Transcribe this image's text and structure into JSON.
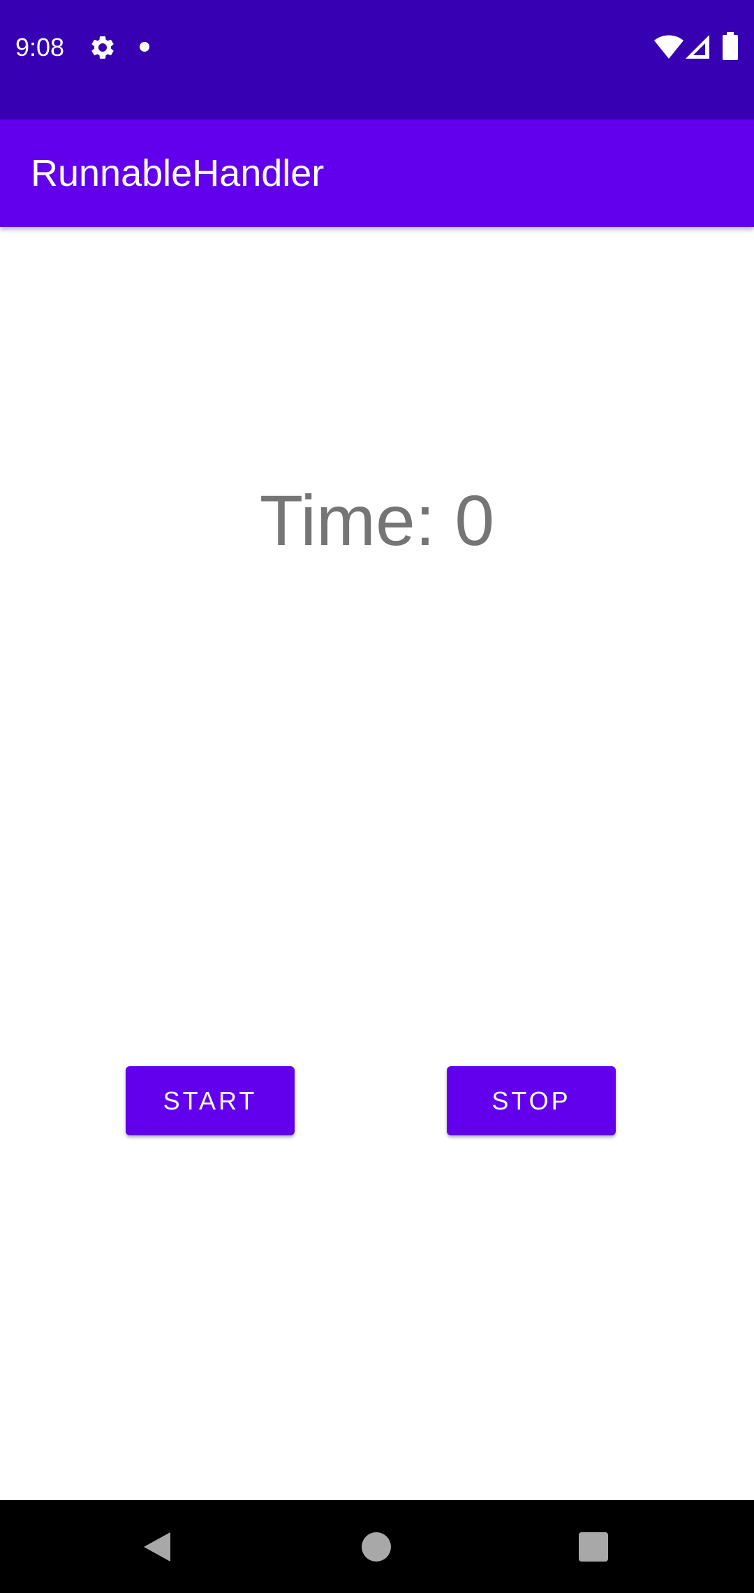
{
  "status_bar": {
    "time": "9:08",
    "icons": [
      "gear-icon",
      "notification-dot-icon",
      "wifi-icon",
      "signal-icon",
      "battery-icon"
    ],
    "background_color": "#3700b3"
  },
  "app_bar": {
    "title": "RunnableHandler",
    "background_color": "#6200ee"
  },
  "main": {
    "time_label": "Time: 0",
    "start_button_label": "START",
    "stop_button_label": "STOP",
    "button_color": "#6200ee"
  },
  "nav_bar": {
    "icons": [
      "back-icon",
      "home-icon",
      "recents-icon"
    ]
  }
}
